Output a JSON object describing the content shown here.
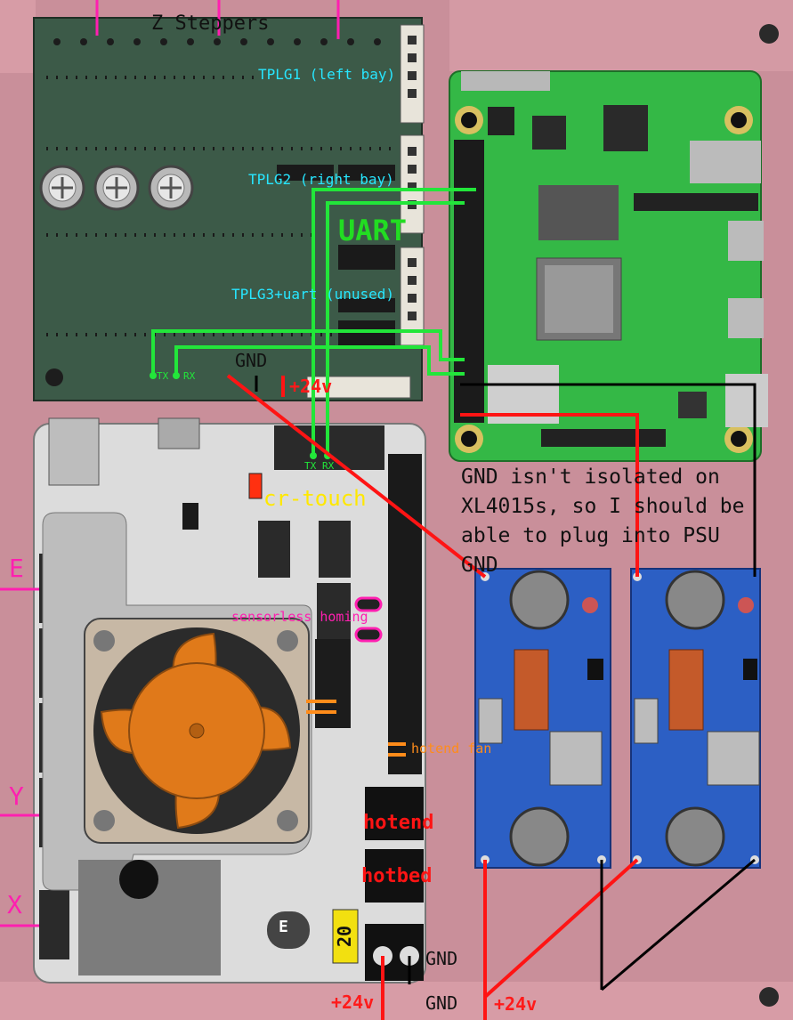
{
  "labels": {
    "z_steppers": "Z Steppers",
    "tplg1": "TPLG1 (left bay)",
    "tplg2": "TPLG2 (right bay)",
    "tplg3": "TPLG3+uart (unused)",
    "uart": "UART",
    "gnd_top": "GND",
    "plus24_top": "+24v",
    "tx_small": "TX",
    "rx_small": "RX",
    "tx_board": "TX",
    "rx_board": "RX",
    "cr_touch": "cr-touch",
    "sensorless": "sensorless homing",
    "hotend_fan": "hotend fan",
    "hotend": "hotend",
    "hotbed": "hotbed",
    "note": "GND isn't isolated on\nXL4015s, so I should be\nable to plug into PSU\nGND",
    "e_axis": "E",
    "y_axis": "Y",
    "x_axis": "X",
    "gnd_bot_a": "GND",
    "gnd_bot_b": "GND",
    "plus24_bot_a": "+24v",
    "plus24_bot_b": "+24v",
    "fuse": "20",
    "cap": "E"
  },
  "colors": {
    "background": "#c98f9a",
    "wire_green": "#22e63a",
    "wire_red": "#ff1414",
    "wire_black": "#000000",
    "uart_label": "#22dd22",
    "cyan_label": "#27e6ff",
    "magenta_label": "#ff1fb0",
    "orange_label": "#ff8c1a",
    "cr_touch_label": "#ffe800"
  },
  "icons": {
    "fan": "cooling-fan-icon",
    "pi": "raspberry-pi-board",
    "buck": "xl4015-buck-converter"
  }
}
